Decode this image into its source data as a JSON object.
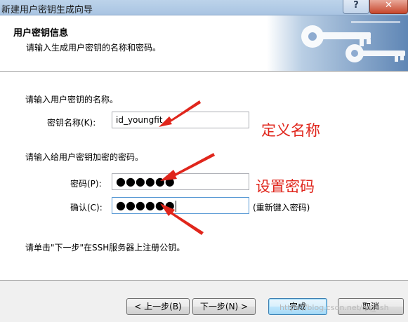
{
  "window": {
    "title": "新建用户密钥生成向导",
    "help_label": "?",
    "close_label": "✕"
  },
  "header": {
    "title": "用户密钥信息",
    "subtitle": "请输入生成用户密钥的名称和密码。"
  },
  "form": {
    "name_prompt": "请输入用户密钥的名称。",
    "key_name_label": "密钥名称(K):",
    "key_name_value": "id_youngfit",
    "password_prompt": "请输入给用户密钥加密的密码。",
    "password_label": "密码(P):",
    "password_value": "●●●●●●",
    "confirm_label": "确认(C):",
    "confirm_value": "●●●●●●",
    "confirm_hint": "(重新键入密码)",
    "instruction": "请单击\"下一步\"在SSH服务器上注册公钥。"
  },
  "annotations": {
    "define_name": "定义名称",
    "set_password": "设置密码",
    "color": "#e0261c"
  },
  "footer": {
    "back_label": "< 上一步(B)",
    "next_label": "下一步(N) >",
    "finish_label": "完成",
    "cancel_label": "取消",
    "watermark": "https://blog.csdn.net/qq_ssh"
  }
}
